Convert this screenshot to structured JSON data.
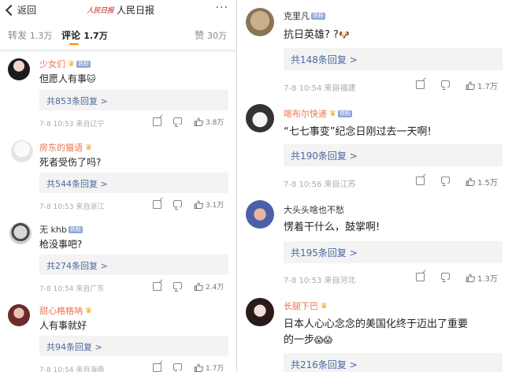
{
  "header": {
    "back_label": "返回",
    "brand_logo_text": "人民日报",
    "title": "人民日报",
    "more_label": "···"
  },
  "tabs": {
    "repost": {
      "label": "转发",
      "count": "1.3万"
    },
    "comment": {
      "label": "评论",
      "count": "1.7万"
    },
    "like": {
      "label": "赞",
      "count": "30万"
    }
  },
  "left_comments": [
    {
      "username": "少女们",
      "text": "但愿人有事",
      "emoji": "🐱",
      "replies": "共853条回复 >",
      "meta": "7-8 10:53 来自辽宁",
      "likes": "3.8万"
    },
    {
      "username": "房东的猫语",
      "text": "死者受伤了吗?",
      "emoji": "",
      "replies": "共544条回复 >",
      "meta": "7-8 10:53 来自浙江",
      "likes": "3.1万"
    },
    {
      "username": "无 khb",
      "text": "枪没事吧?",
      "emoji": "",
      "replies": "共274条回复 >",
      "meta": "7-8 10:54 来自广东",
      "likes": "2.4万"
    },
    {
      "username": "甜心格格呐",
      "text": "人有事就好",
      "emoji": "",
      "replies": "共94条回复 >",
      "meta": "7-8 10:54 来自海南",
      "likes": "1.7万"
    }
  ],
  "right_comments": [
    {
      "username": "克里凡",
      "text": "抗日英雄? ?",
      "emoji": "🐶",
      "replies": "共148条回复 >",
      "meta": "7-8 10:54 来自福建",
      "likes": "1.7万"
    },
    {
      "username": "喀布尔快递",
      "text": "“七七事变”纪念日刚过去一天啊!",
      "emoji": "",
      "replies": "共190条回复 >",
      "meta": "7-8 10:56 来自江苏",
      "likes": "1.5万"
    },
    {
      "username": "大头头啥也不愁",
      "text": "愣着干什么，鼓掌啊!",
      "emoji": "",
      "replies": "共195条回复 >",
      "meta": "7-8 10:53 来自河北",
      "likes": "1.3万"
    },
    {
      "username": "长腿下巴",
      "text": "日本人心心念念的美国化终于迈出了重要",
      "text2": "的一步",
      "emoji": "😱😱",
      "replies": "共216条回复 >",
      "meta": "",
      "likes": ""
    }
  ],
  "colors": {
    "accent": "#ff8200",
    "username": "#eb7350",
    "reply_link": "#4a6aa0",
    "vip_crown": "#f5a623"
  }
}
